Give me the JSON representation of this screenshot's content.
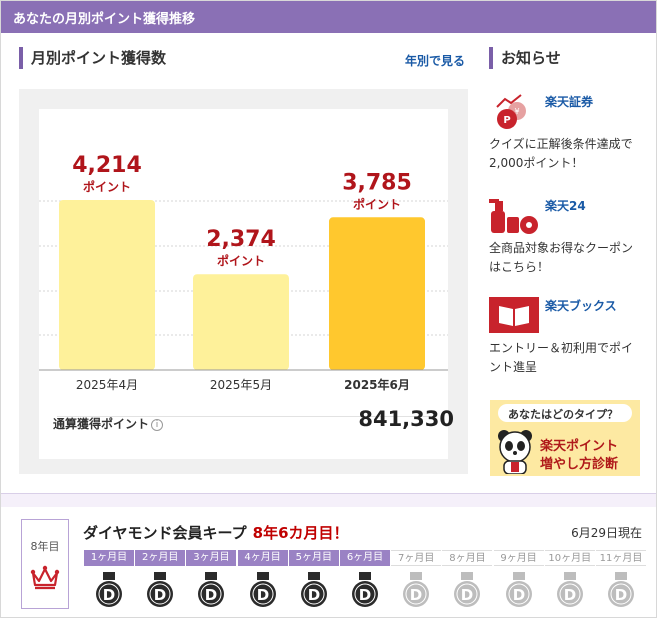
{
  "header": {
    "title": "あなたの月別ポイント獲得推移"
  },
  "monthly": {
    "title": "月別ポイント獲得数",
    "yearly_link": "年別で見る"
  },
  "chart_data": {
    "type": "bar",
    "categories": [
      "2025年4月",
      "2025年5月",
      "2025年6月"
    ],
    "values": [
      4214,
      2374,
      3785
    ],
    "value_labels": [
      "4,214",
      "2,374",
      "3,785"
    ],
    "unit_label": "ポイント",
    "highlight_index": 2,
    "colors": {
      "normal": "#fef19a",
      "highlight": "#ffc82e",
      "value": "#b0151b"
    }
  },
  "total": {
    "label": "通算獲得ポイント",
    "info": "i",
    "value": "841,330"
  },
  "news": {
    "title": "お知らせ",
    "items": [
      {
        "brand": "楽天証券",
        "text": "クイズに正解後条件達成で2,000ポイント！",
        "icon": "point-bag-icon"
      },
      {
        "brand": "楽天24",
        "text": "全商品対象お得なクーポンはこちら！",
        "icon": "cleaning-bottle-icon"
      },
      {
        "brand": "楽天ブックス",
        "text": "エントリー＆初利用でポイント進呈",
        "icon": "book-icon"
      }
    ],
    "banner": {
      "question": "あなたはどのタイプ？",
      "line1": "楽天ポイント",
      "line2": "増やし方診断"
    }
  },
  "membership": {
    "rank_year": "8年目",
    "title": "ダイヤモンド会員キープ",
    "months_kept": "8年6カ月目！",
    "as_of": "6月29日現在",
    "months": [
      "1ヶ月目",
      "2ヶ月目",
      "3ヶ月目",
      "4ヶ月目",
      "5ヶ月目",
      "6ヶ月目",
      "7ヶ月目",
      "8ヶ月目",
      "9ヶ月目",
      "10ヶ月目",
      "11ヶ月目"
    ],
    "completed": 6,
    "medal_letter": "D"
  }
}
